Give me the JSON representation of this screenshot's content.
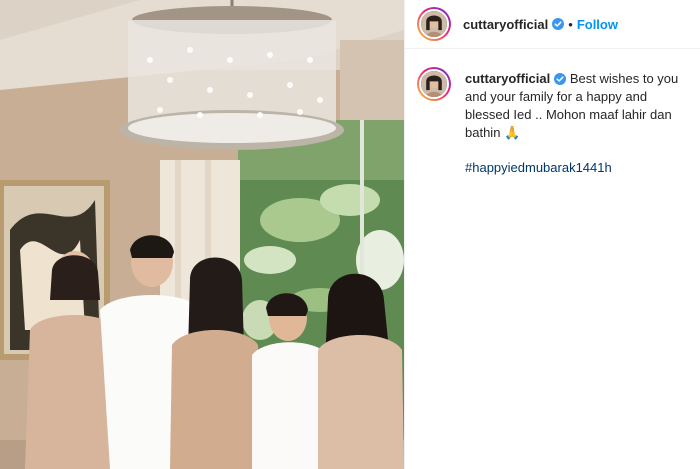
{
  "post": {
    "image_alt": "Family photo under a crystal chandelier"
  },
  "header": {
    "username": "cuttaryofficial",
    "separator": "•",
    "follow_label": "Follow"
  },
  "caption": {
    "username": "cuttaryofficial",
    "text": "Best wishes to you and your family for a happy and blessed Ied .. Mohon maaf lahir dan bathin",
    "emoji": "🙏",
    "hashtag": "#happyiedmubarak1441h"
  },
  "colors": {
    "accent": "#0095f6",
    "verified": "#3897f0",
    "hashtag": "#00376b"
  },
  "icons": {
    "verified": "verified-badge-icon",
    "pray": "folded-hands-emoji"
  }
}
